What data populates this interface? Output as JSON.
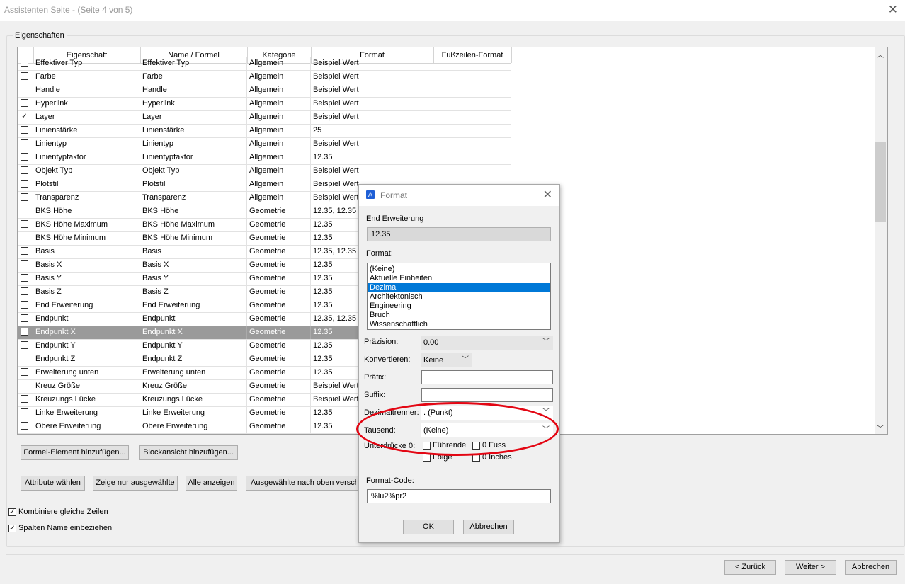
{
  "window": {
    "title": "Assistenten Seite - (Seite 4 von 5)",
    "close": "✕"
  },
  "group_label": "Eigenschaften",
  "columns": [
    "Eigenschaft",
    "Name / Formel",
    "Kategorie",
    "Format",
    "Fußzeilen-Format"
  ],
  "rows": [
    {
      "p": "Effektiver Typ",
      "n": "Effektiver Typ",
      "k": "Allgemein",
      "f": "Beispiel Wert",
      "c": false
    },
    {
      "p": "Farbe",
      "n": "Farbe",
      "k": "Allgemein",
      "f": "Beispiel Wert",
      "c": false
    },
    {
      "p": "Handle",
      "n": "Handle",
      "k": "Allgemein",
      "f": "Beispiel Wert",
      "c": false
    },
    {
      "p": "Hyperlink",
      "n": "Hyperlink",
      "k": "Allgemein",
      "f": "Beispiel Wert",
      "c": false
    },
    {
      "p": "Layer",
      "n": "Layer",
      "k": "Allgemein",
      "f": "Beispiel Wert",
      "c": true
    },
    {
      "p": "Linienstärke",
      "n": "Linienstärke",
      "k": "Allgemein",
      "f": "25",
      "c": false
    },
    {
      "p": "Linientyp",
      "n": "Linientyp",
      "k": "Allgemein",
      "f": "Beispiel Wert",
      "c": false
    },
    {
      "p": "Linientypfaktor",
      "n": "Linientypfaktor",
      "k": "Allgemein",
      "f": "12.35",
      "c": false
    },
    {
      "p": "Objekt Typ",
      "n": "Objekt Typ",
      "k": "Allgemein",
      "f": "Beispiel Wert",
      "c": false
    },
    {
      "p": "Plotstil",
      "n": "Plotstil",
      "k": "Allgemein",
      "f": "Beispiel Wert",
      "c": false
    },
    {
      "p": "Transparenz",
      "n": "Transparenz",
      "k": "Allgemein",
      "f": "Beispiel Wert",
      "c": false
    },
    {
      "p": "BKS Höhe",
      "n": "BKS Höhe",
      "k": "Geometrie",
      "f": "12.35, 12.35",
      "c": false
    },
    {
      "p": "BKS Höhe Maximum",
      "n": "BKS Höhe Maximum",
      "k": "Geometrie",
      "f": "12.35",
      "c": false
    },
    {
      "p": "BKS Höhe Minimum",
      "n": "BKS Höhe Minimum",
      "k": "Geometrie",
      "f": "12.35",
      "c": false
    },
    {
      "p": "Basis",
      "n": "Basis",
      "k": "Geometrie",
      "f": "12.35, 12.35",
      "c": false
    },
    {
      "p": "Basis X",
      "n": "Basis X",
      "k": "Geometrie",
      "f": "12.35",
      "c": false
    },
    {
      "p": "Basis Y",
      "n": "Basis Y",
      "k": "Geometrie",
      "f": "12.35",
      "c": false
    },
    {
      "p": "Basis Z",
      "n": "Basis Z",
      "k": "Geometrie",
      "f": "12.35",
      "c": false
    },
    {
      "p": "End Erweiterung",
      "n": "End Erweiterung",
      "k": "Geometrie",
      "f": "12.35",
      "c": false
    },
    {
      "p": "Endpunkt",
      "n": "Endpunkt",
      "k": "Geometrie",
      "f": "12.35, 12.35",
      "c": false
    },
    {
      "p": "Endpunkt X",
      "n": "Endpunkt X",
      "k": "Geometrie",
      "f": "12.35",
      "c": false,
      "sel": true
    },
    {
      "p": "Endpunkt Y",
      "n": "Endpunkt Y",
      "k": "Geometrie",
      "f": "12.35",
      "c": false
    },
    {
      "p": "Endpunkt Z",
      "n": "Endpunkt Z",
      "k": "Geometrie",
      "f": "12.35",
      "c": false
    },
    {
      "p": "Erweiterung unten",
      "n": "Erweiterung unten",
      "k": "Geometrie",
      "f": "12.35",
      "c": false
    },
    {
      "p": "Kreuz Größe",
      "n": "Kreuz Größe",
      "k": "Geometrie",
      "f": "Beispiel Wert",
      "c": false
    },
    {
      "p": "Kreuzungs Lücke",
      "n": "Kreuzungs Lücke",
      "k": "Geometrie",
      "f": "Beispiel Wert",
      "c": false
    },
    {
      "p": "Linke Erweiterung",
      "n": "Linke Erweiterung",
      "k": "Geometrie",
      "f": "12.35",
      "c": false
    },
    {
      "p": "Obere Erweiterung",
      "n": "Obere Erweiterung",
      "k": "Geometrie",
      "f": "12.35",
      "c": false
    }
  ],
  "buttons": {
    "formel": "Formel-Element hinzufügen...",
    "block": "Blockansicht hinzufügen...",
    "attribute": "Attribute wählen",
    "zeige": "Zeige nur ausgewählte",
    "alle": "Alle anzeigen",
    "nach_oben": "Ausgewählte nach oben verschieben"
  },
  "options": {
    "kombiniere": "Kombiniere gleiche Zeilen",
    "spalten": "Spalten Name einbeziehen"
  },
  "nav": {
    "back": "< Zurück",
    "next": "Weiter >",
    "cancel": "Abbrechen"
  },
  "dialog": {
    "title": "Format",
    "icon_glyph": "A",
    "close": "✕",
    "field_label": "End Erweiterung",
    "field_value": "12.35",
    "format_label": "Format:",
    "formats": [
      "(Keine)",
      "Aktuelle Einheiten",
      "Dezimal",
      "Architektonisch",
      "Engineering",
      "Bruch",
      "Wissenschaftlich"
    ],
    "selected_format": 2,
    "praezision_label": "Präzision:",
    "praezision": "0.00",
    "konvertieren_label": "Konvertieren:",
    "konvertieren": "Keine",
    "praefix_label": "Präfix:",
    "praefix": "",
    "suffix_label": "Suffix:",
    "suffix": "",
    "dezimal_label": "Dezimaltrenner:",
    "dezimal": ". (Punkt)",
    "tausend_label": "Tausend:",
    "tausend": "(Keine)",
    "unterdruecke_label": "Unterdrücke 0:",
    "fuehrende": "Führende",
    "fuss": "0 Fuss",
    "folge": "Folge",
    "inches": "0 Inches",
    "format_code_label": "Format-Code:",
    "format_code": "%lu2%pr2",
    "ok": "OK",
    "cancel": "Abbrechen"
  },
  "highlight_color": "#e30613"
}
